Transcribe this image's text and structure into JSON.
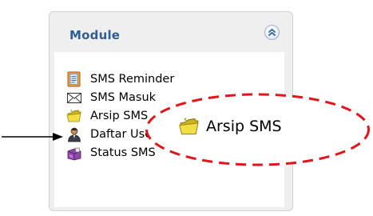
{
  "module": {
    "title": "Module",
    "collapse_icon": "double-chevron-up-icon"
  },
  "menu": {
    "items": [
      {
        "label": "SMS Reminder",
        "icon": "notepad-icon"
      },
      {
        "label": "SMS Masuk",
        "icon": "envelope-icon"
      },
      {
        "label": "Arsip SMS",
        "icon": "folder-icon"
      },
      {
        "label": "Daftar User",
        "icon": "user-icon"
      },
      {
        "label": "Status SMS",
        "icon": "chart-icon"
      }
    ]
  },
  "callout": {
    "label": "Arsip SMS",
    "icon": "folder-icon",
    "border_color": "#e4141b"
  },
  "annotation": {
    "arrow_icon": "arrow-right-icon"
  }
}
